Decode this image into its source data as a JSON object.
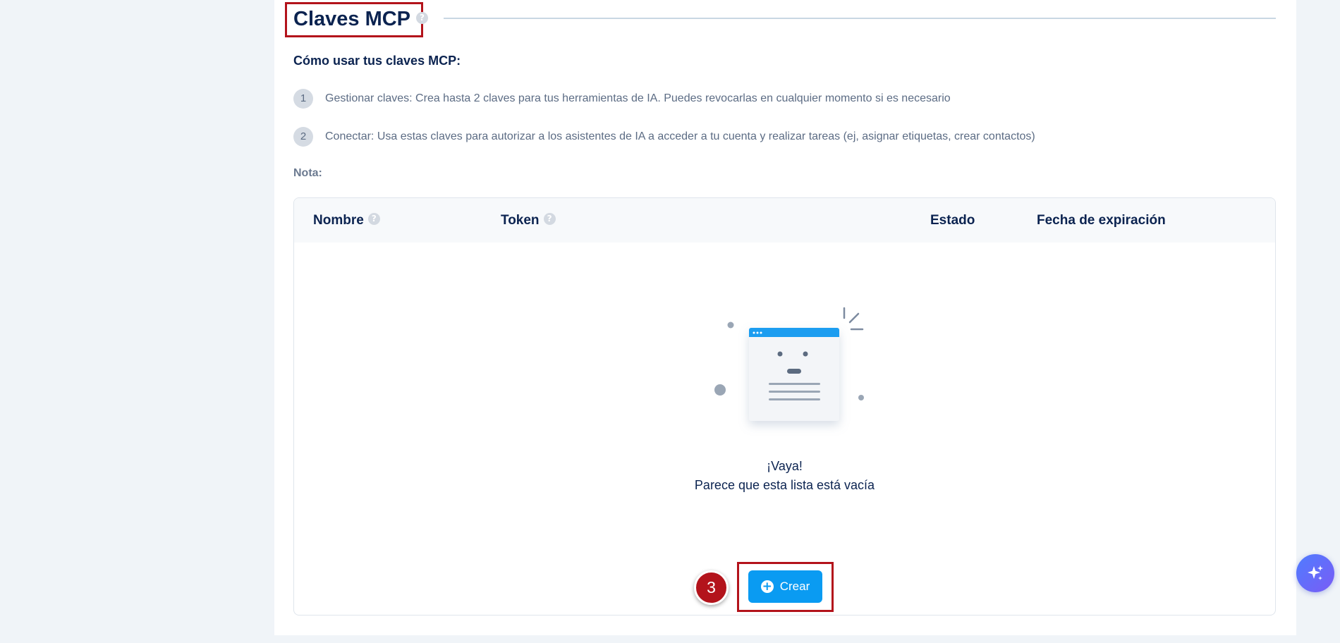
{
  "section": {
    "title": "Claves MCP",
    "help_glyph": "?"
  },
  "howto": {
    "heading": "Cómo usar tus claves MCP:",
    "steps": [
      {
        "num": "1",
        "text": "Gestionar claves: Crea hasta 2 claves para tus herramientas de IA. Puedes revocarlas en cualquier momento si es necesario"
      },
      {
        "num": "2",
        "text": "Conectar: Usa estas claves para autorizar a los asistentes de IA a acceder a tu cuenta y realizar tareas (ej, asignar etiquetas, crear contactos)"
      }
    ],
    "note_label": "Nota:"
  },
  "table": {
    "columns": [
      "Nombre",
      "Token",
      "Estado",
      "Fecha de expiración"
    ],
    "empty_title": "¡Vaya!",
    "empty_subtitle": "Parece que esta lista está vacía"
  },
  "actions": {
    "create_label": "Crear",
    "create_icon": "plus-circle-icon"
  },
  "annotations": {
    "step_badge": "3",
    "highlight_color": "#b3131b"
  },
  "colors": {
    "primary": "#0a9bf2",
    "heading": "#0b2350",
    "page_bg": "#f0f4f8"
  },
  "fab": {
    "icon": "ai-sparkle-icon"
  }
}
